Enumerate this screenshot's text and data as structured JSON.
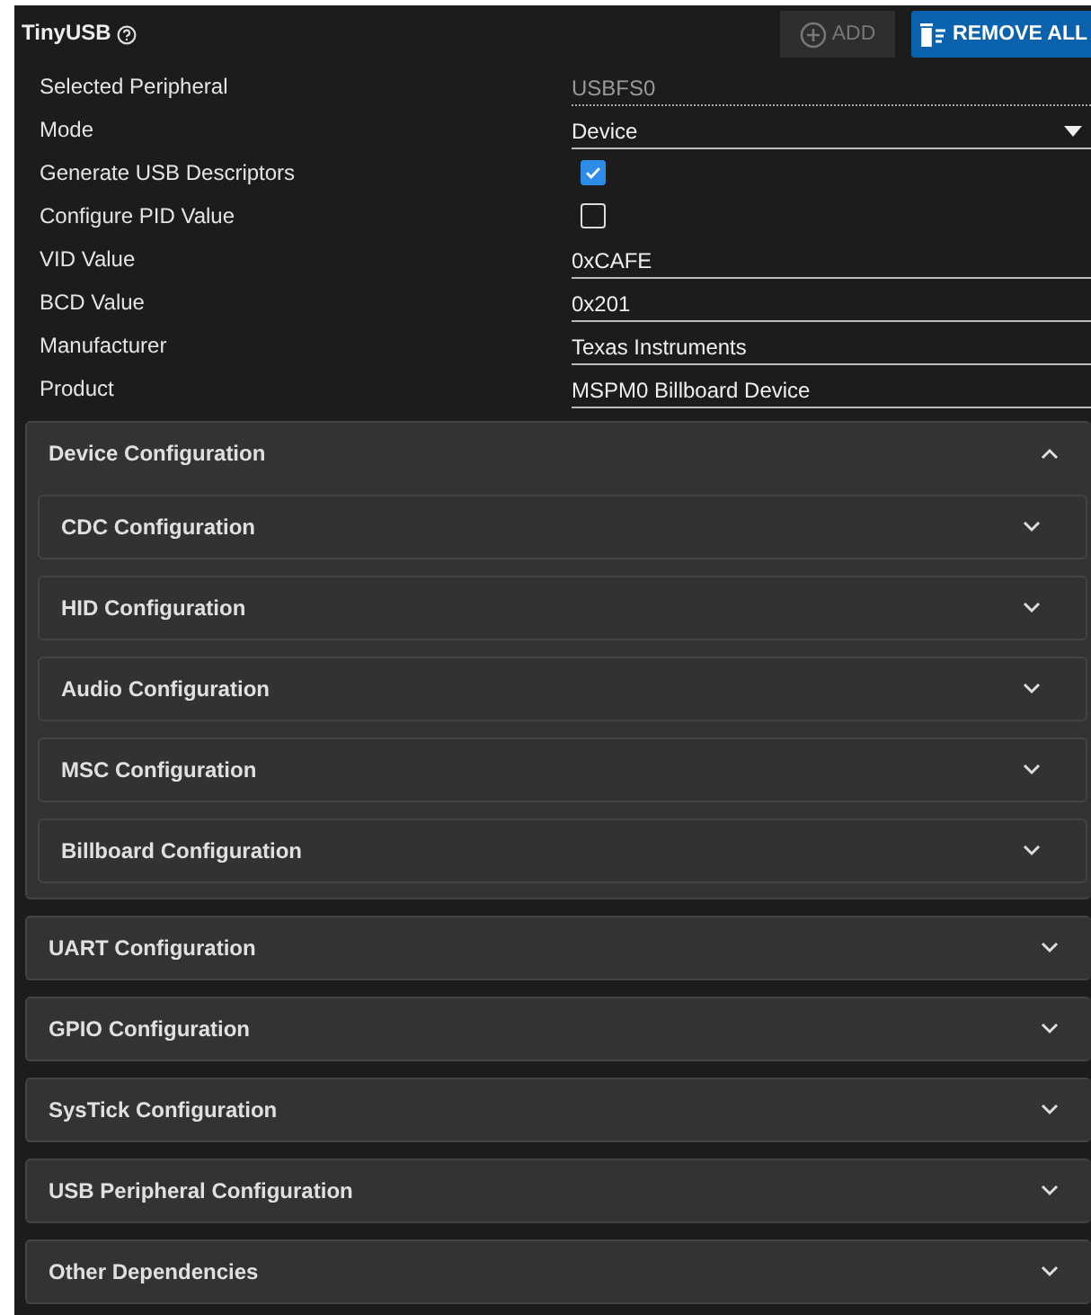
{
  "panel": {
    "title": "TinyUSB",
    "add_button": {
      "label": "ADD",
      "disabled": true
    },
    "remove_button": {
      "label": "REMOVE ALL",
      "disabled": false
    }
  },
  "fields": [
    {
      "label": "Selected Peripheral",
      "kind": "readonly",
      "value": "USBFS0"
    },
    {
      "label": "Mode",
      "kind": "select",
      "value": "Device"
    },
    {
      "label": "Generate USB Descriptors",
      "kind": "checkbox",
      "checked": true
    },
    {
      "label": "Configure PID Value",
      "kind": "checkbox",
      "checked": false
    },
    {
      "label": "VID Value",
      "kind": "text",
      "value": "0xCAFE"
    },
    {
      "label": "BCD Value",
      "kind": "text",
      "value": "0x201"
    },
    {
      "label": "Manufacturer",
      "kind": "text",
      "value": "Texas Instruments"
    },
    {
      "label": "Product",
      "kind": "text",
      "value": "MSPM0 Billboard Device"
    }
  ],
  "sections": [
    {
      "title": "Device Configuration",
      "expanded": true,
      "children": [
        {
          "title": "CDC Configuration",
          "expanded": false
        },
        {
          "title": "HID Configuration",
          "expanded": false
        },
        {
          "title": "Audio Configuration",
          "expanded": false
        },
        {
          "title": "MSC Configuration",
          "expanded": false
        },
        {
          "title": "Billboard Configuration",
          "expanded": false
        }
      ]
    },
    {
      "title": "UART Configuration",
      "expanded": false
    },
    {
      "title": "GPIO Configuration",
      "expanded": false
    },
    {
      "title": "SysTick Configuration",
      "expanded": false
    },
    {
      "title": "USB Peripheral Configuration",
      "expanded": false
    },
    {
      "title": "Other Dependencies",
      "expanded": false
    }
  ]
}
